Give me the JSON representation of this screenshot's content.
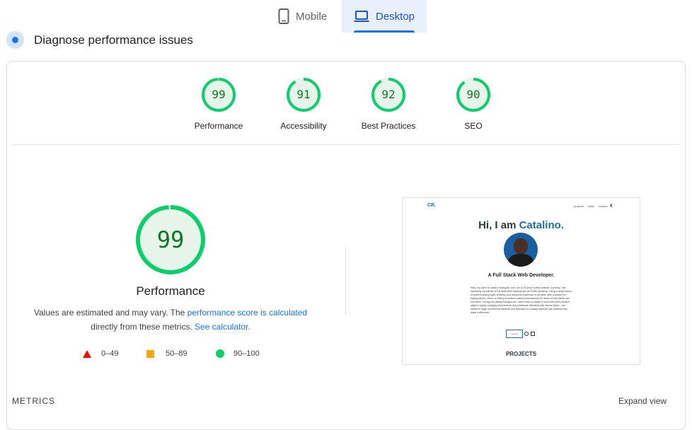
{
  "tabs": {
    "mobile": "Mobile",
    "desktop": "Desktop"
  },
  "diagnose": {
    "title": "Diagnose performance issues"
  },
  "scores": [
    {
      "value": "99",
      "label": "Performance",
      "fraction": 0.99
    },
    {
      "value": "91",
      "label": "Accessibility",
      "fraction": 0.91
    },
    {
      "value": "92",
      "label": "Best Practices",
      "fraction": 0.92
    },
    {
      "value": "90",
      "label": "SEO",
      "fraction": 0.9
    }
  ],
  "performance": {
    "score": "99",
    "fraction": 0.99,
    "label": "Performance",
    "desc_pre": "Values are estimated and may vary. The ",
    "desc_link": "performance score is calculated",
    "desc_mid": "directly from these metrics. ",
    "desc_link2": "See calculator."
  },
  "legend": {
    "fail": "0–49",
    "average": "50–89",
    "pass": "90–100"
  },
  "colors": {
    "pass": "#0cce6b",
    "pass_bg": "#e6f4ea",
    "pass_text": "#0b7a1f",
    "average": "#ffa400",
    "fail": "#ff4e42",
    "accent": "#1a73e8"
  },
  "preview": {
    "logo": "CR.",
    "nav": [
      "projects",
      "skills",
      "contact"
    ],
    "heading_pre": "Hi, I am ",
    "heading_name": "Catalino.",
    "subtitle": "A Full Stack Web Developer.",
    "bio": "Hello, my name is Catalino Rodriguez, and I am a US Army Combat Veteran. Currently, I am expanding my skill set in Full Stack Web Development at LEARN Academy. I bring a unique blend of problem-solving skills, creativity, and real-world experience to the table. With a passion for helping others, I thrive on finding innovative solutions that address the needs of both clients and end-users. Through my military background, I have honed my ability to work well under pressure, adapt to rapidly changing environments, and collaborate effectively with diverse teams. I am excited to apply my technical expertise and dedication to creating impactful web solutions that make a difference.",
    "resume_button": "resume",
    "projects_heading": "PROJECTS"
  },
  "footer": {
    "metrics": "METRICS",
    "expand": "Expand view"
  }
}
